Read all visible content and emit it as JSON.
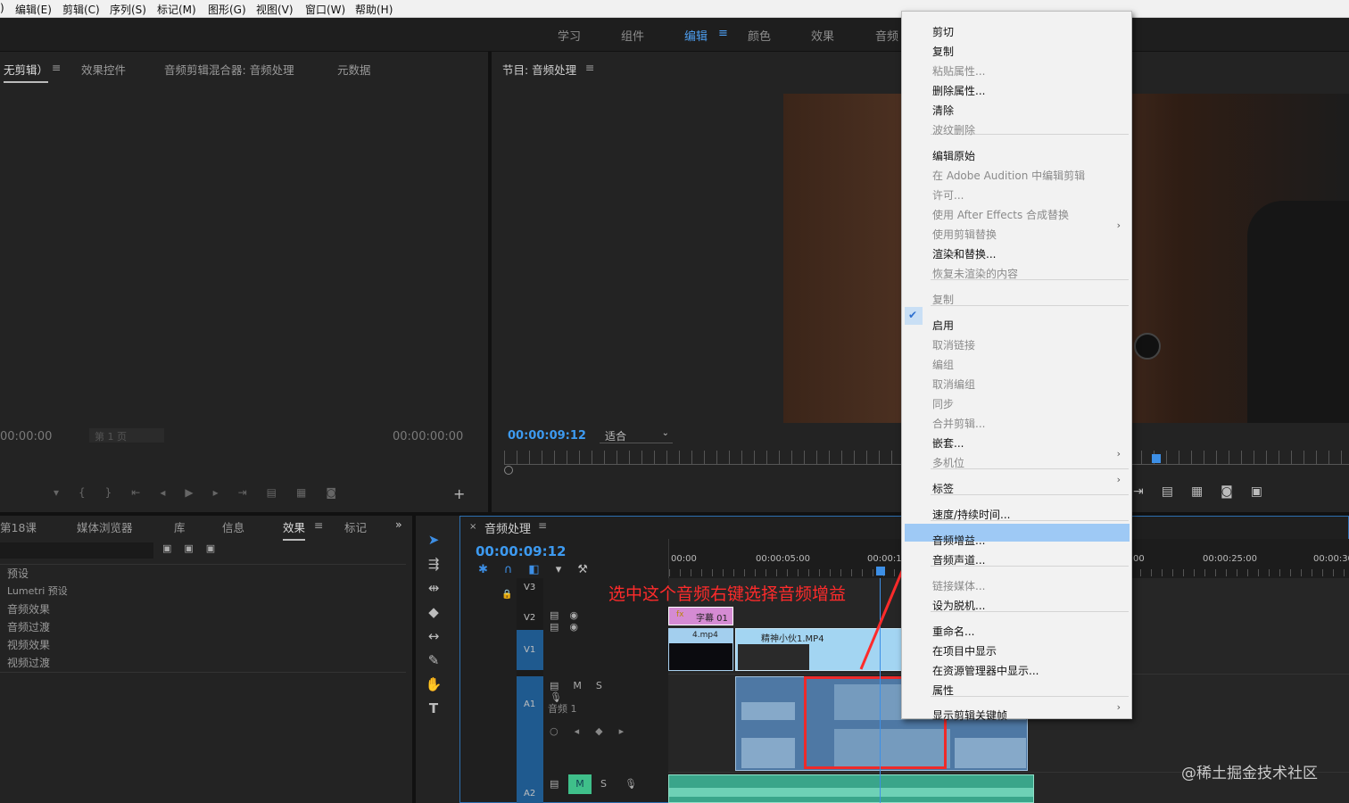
{
  "menubar": [
    "编辑(E)",
    "剪辑(C)",
    "序列(S)",
    "标记(M)",
    "图形(G)",
    "视图(V)",
    "窗口(W)",
    "帮助(H)"
  ],
  "workspaces": [
    "学习",
    "组件",
    "编辑",
    "颜色",
    "效果",
    "音频"
  ],
  "source_panel": {
    "tabs": [
      "无剪辑）",
      "效果控件",
      "音频剪辑混合器: 音频处理",
      "元数据"
    ],
    "timecode_left": "00:00:00",
    "page": "第 1 页",
    "timecode_right": "00:00:00:00"
  },
  "program_panel": {
    "title": "节目: 音频处理",
    "timecode": "00:00:09:12",
    "fit": "适合"
  },
  "project_panel": {
    "tabs": [
      "第18课",
      "媒体浏览器",
      "库",
      "信息",
      "效果",
      "标记"
    ],
    "tree": [
      "预设",
      "Lumetri 预设",
      "音频效果",
      "音频过渡",
      "视频效果",
      "视频过渡"
    ]
  },
  "timeline": {
    "tab": "音频处理",
    "timecode": "00:00:09:12",
    "ruler": [
      "00:00",
      "00:00:05:00",
      "00:00:1",
      "00",
      "00:00:25:00",
      "00:00:30"
    ],
    "tracks": {
      "v3": "V3",
      "v2": "V2",
      "v1": "V1",
      "a1": "A1",
      "a1_name": "音频 1",
      "a2": "A2"
    },
    "clips": {
      "title_clip": "字幕 01",
      "clip_a": "4.mp4",
      "clip_b": "精神小伙1.MP4"
    }
  },
  "annotation": "选中这个音频右键选择音频增益",
  "watermark": "@稀土掘金技术社区",
  "context_menu": [
    {
      "label": "剪切",
      "enabled": true
    },
    {
      "label": "复制",
      "enabled": true
    },
    {
      "label": "粘贴属性...",
      "enabled": false
    },
    {
      "label": "删除属性...",
      "enabled": true
    },
    {
      "label": "清除",
      "enabled": true
    },
    {
      "label": "波纹删除",
      "enabled": false
    },
    {
      "label": "编辑原始",
      "enabled": true
    },
    {
      "label": "在 Adobe Audition 中编辑剪辑",
      "enabled": false
    },
    {
      "label": "许可...",
      "enabled": false
    },
    {
      "label": "使用 After Effects 合成替换",
      "enabled": false
    },
    {
      "label": "使用剪辑替换",
      "enabled": false
    },
    {
      "label": "渲染和替换...",
      "enabled": true
    },
    {
      "label": "恢复未渲染的内容",
      "enabled": false
    },
    {
      "label": "复制",
      "enabled": false
    },
    {
      "label": "启用",
      "enabled": true
    },
    {
      "label": "取消链接",
      "enabled": false
    },
    {
      "label": "编组",
      "enabled": false
    },
    {
      "label": "取消编组",
      "enabled": false
    },
    {
      "label": "同步",
      "enabled": false
    },
    {
      "label": "合并剪辑...",
      "enabled": false
    },
    {
      "label": "嵌套...",
      "enabled": true
    },
    {
      "label": "多机位",
      "enabled": false
    },
    {
      "label": "标签",
      "enabled": true
    },
    {
      "label": "速度/持续时间...",
      "enabled": true
    },
    {
      "label": "音频增益...",
      "enabled": true
    },
    {
      "label": "音频声道...",
      "enabled": true
    },
    {
      "label": "链接媒体...",
      "enabled": false
    },
    {
      "label": "设为脱机...",
      "enabled": true
    },
    {
      "label": "重命名...",
      "enabled": true
    },
    {
      "label": "在项目中显示",
      "enabled": true
    },
    {
      "label": "在资源管理器中显示...",
      "enabled": true
    },
    {
      "label": "属性",
      "enabled": true
    },
    {
      "label": "显示剪辑关键帧",
      "enabled": true
    }
  ]
}
